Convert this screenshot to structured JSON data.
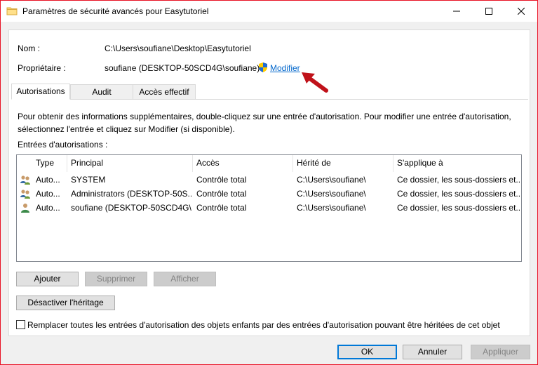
{
  "window": {
    "title": "Paramètres de sécurité avancés pour Easytutoriel",
    "accent": "#e81123"
  },
  "info": {
    "name_label": "Nom :",
    "name_value": "C:\\Users\\soufiane\\Desktop\\Easytutoriel",
    "owner_label": "Propriétaire :",
    "owner_value": "soufiane (DESKTOP-50SCD4G\\soufiane)",
    "owner_change_link": "Modifier"
  },
  "tabs": [
    {
      "label": "Autorisations",
      "active": true
    },
    {
      "label": "Audit",
      "active": false
    },
    {
      "label": "Accès effectif",
      "active": false
    }
  ],
  "description": "Pour obtenir des informations supplémentaires, double-cliquez sur une entrée d'autorisation. Pour modifier une entrée d'autorisation, sélectionnez l'entrée et cliquez sur Modifier (si disponible).",
  "entries_label": "Entrées d'autorisations :",
  "table": {
    "columns": [
      "Type",
      "Principal",
      "Accès",
      "Hérité de",
      "S'applique à"
    ],
    "rows": [
      {
        "icon": "group-users-icon",
        "type": "Auto...",
        "principal": "SYSTEM",
        "access": "Contrôle total",
        "inherited": "C:\\Users\\soufiane\\",
        "applies": "Ce dossier, les sous-dossiers et..."
      },
      {
        "icon": "group-users-icon",
        "type": "Auto...",
        "principal": "Administrators (DESKTOP-50S...",
        "access": "Contrôle total",
        "inherited": "C:\\Users\\soufiane\\",
        "applies": "Ce dossier, les sous-dossiers et..."
      },
      {
        "icon": "single-user-icon",
        "type": "Auto...",
        "principal": "soufiane (DESKTOP-50SCD4G\\...",
        "access": "Contrôle total",
        "inherited": "C:\\Users\\soufiane\\",
        "applies": "Ce dossier, les sous-dossiers et..."
      }
    ]
  },
  "buttons": {
    "add": "Ajouter",
    "remove": "Supprimer",
    "view": "Afficher",
    "disable_inheritance": "Désactiver l'héritage",
    "ok": "OK",
    "cancel": "Annuler",
    "apply": "Appliquer"
  },
  "replace_checkbox": {
    "label": "Remplacer toutes les entrées d'autorisation des objets enfants par des entrées d'autorisation pouvant être héritées de cet objet",
    "checked": false
  }
}
